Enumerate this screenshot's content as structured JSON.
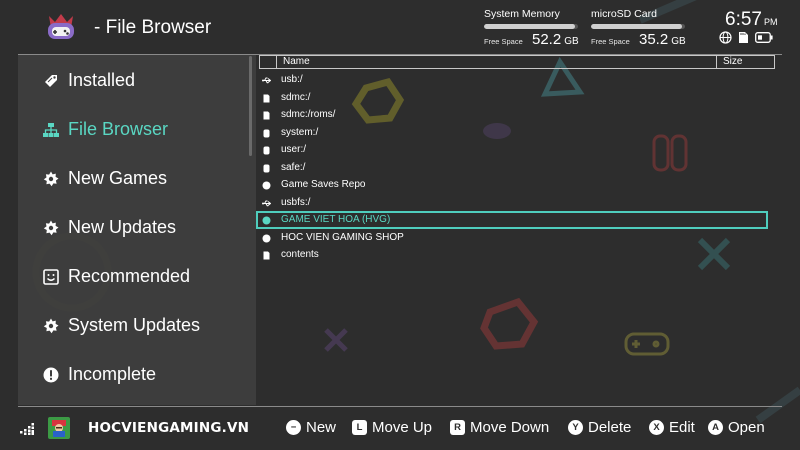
{
  "header": {
    "title": "- File Browser",
    "storage": [
      {
        "label": "System Memory",
        "free_label": "Free Space",
        "free_value": "52.2",
        "unit": "GB",
        "used_fraction": 0.97
      },
      {
        "label": "microSD Card",
        "free_label": "Free Space",
        "free_value": "35.2",
        "unit": "GB",
        "used_fraction": 0.97
      }
    ],
    "time": "6:57",
    "ampm": "PM",
    "status_icons": [
      "globe-icon",
      "sd-card-icon",
      "battery-icon"
    ]
  },
  "sidebar": {
    "items": [
      {
        "label": "Installed",
        "icon": "tag-icon",
        "active": false
      },
      {
        "label": "File Browser",
        "icon": "tree-icon",
        "active": true
      },
      {
        "label": "New Games",
        "icon": "burst-icon",
        "active": false
      },
      {
        "label": "New Updates",
        "icon": "burst-icon",
        "active": false
      },
      {
        "label": "Recommended",
        "icon": "smile-box-icon",
        "active": false
      },
      {
        "label": "System Updates",
        "icon": "burst-icon",
        "active": false
      },
      {
        "label": "Incomplete",
        "icon": "exclamation-icon",
        "active": false
      }
    ]
  },
  "filelist": {
    "columns": {
      "name": "Name",
      "size": "Size"
    },
    "rows": [
      {
        "name": "usb:/",
        "icon": "usb-icon",
        "selected": false
      },
      {
        "name": "sdmc:/",
        "icon": "file-icon",
        "selected": false
      },
      {
        "name": "sdmc:/roms/",
        "icon": "file-icon",
        "selected": false
      },
      {
        "name": "system:/",
        "icon": "cylinder-icon",
        "selected": false
      },
      {
        "name": "user:/",
        "icon": "cylinder-icon",
        "selected": false
      },
      {
        "name": "safe:/",
        "icon": "cylinder-icon",
        "selected": false
      },
      {
        "name": "Game Saves Repo",
        "icon": "globe-icon",
        "selected": false
      },
      {
        "name": "usbfs:/",
        "icon": "usb-icon",
        "selected": false
      },
      {
        "name": "GAME VIET HOA (HVG)",
        "icon": "globe-icon",
        "selected": true
      },
      {
        "name": "HOC VIEN GAMING SHOP",
        "icon": "globe-icon",
        "selected": false
      },
      {
        "name": "contents",
        "icon": "file-icon",
        "selected": false
      }
    ]
  },
  "footer": {
    "brand": "HOCVIENGAMING.VN",
    "hints": [
      {
        "button": "−",
        "label": "New",
        "shape": "circle"
      },
      {
        "button": "L",
        "label": "Move Up",
        "shape": "square"
      },
      {
        "button": "R",
        "label": "Move Down",
        "shape": "square"
      },
      {
        "button": "Y",
        "label": "Delete",
        "shape": "circle"
      },
      {
        "button": "X",
        "label": "Edit",
        "shape": "circle"
      },
      {
        "button": "A",
        "label": "Open",
        "shape": "circle"
      }
    ]
  },
  "colors": {
    "background": "#2d2d2d",
    "sidebar": "#3e3e3e",
    "accent": "#5ad7c3",
    "selection_border": "#4fcdbd"
  }
}
